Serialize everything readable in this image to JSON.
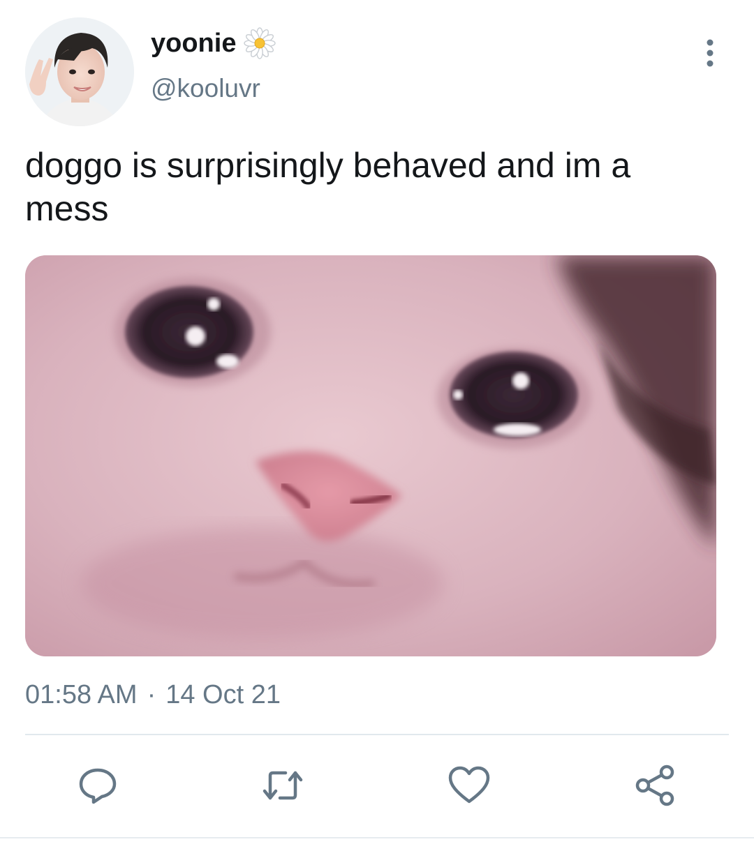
{
  "tweet": {
    "display_name": "yoonie",
    "handle": "@kooluvr",
    "text": "doggo is surprisingly behaved and im a mess",
    "time": "01:58 AM",
    "separator": "·",
    "date": "14 Oct 21"
  },
  "icons": {
    "name_badge": "daisy-icon",
    "more": "more-vertical-icon",
    "reply": "reply-icon",
    "retweet": "retweet-icon",
    "like": "heart-icon",
    "share": "share-icon"
  },
  "colors": {
    "text_primary": "#14171a",
    "text_secondary": "#657786",
    "divider": "#e1e8ed"
  }
}
